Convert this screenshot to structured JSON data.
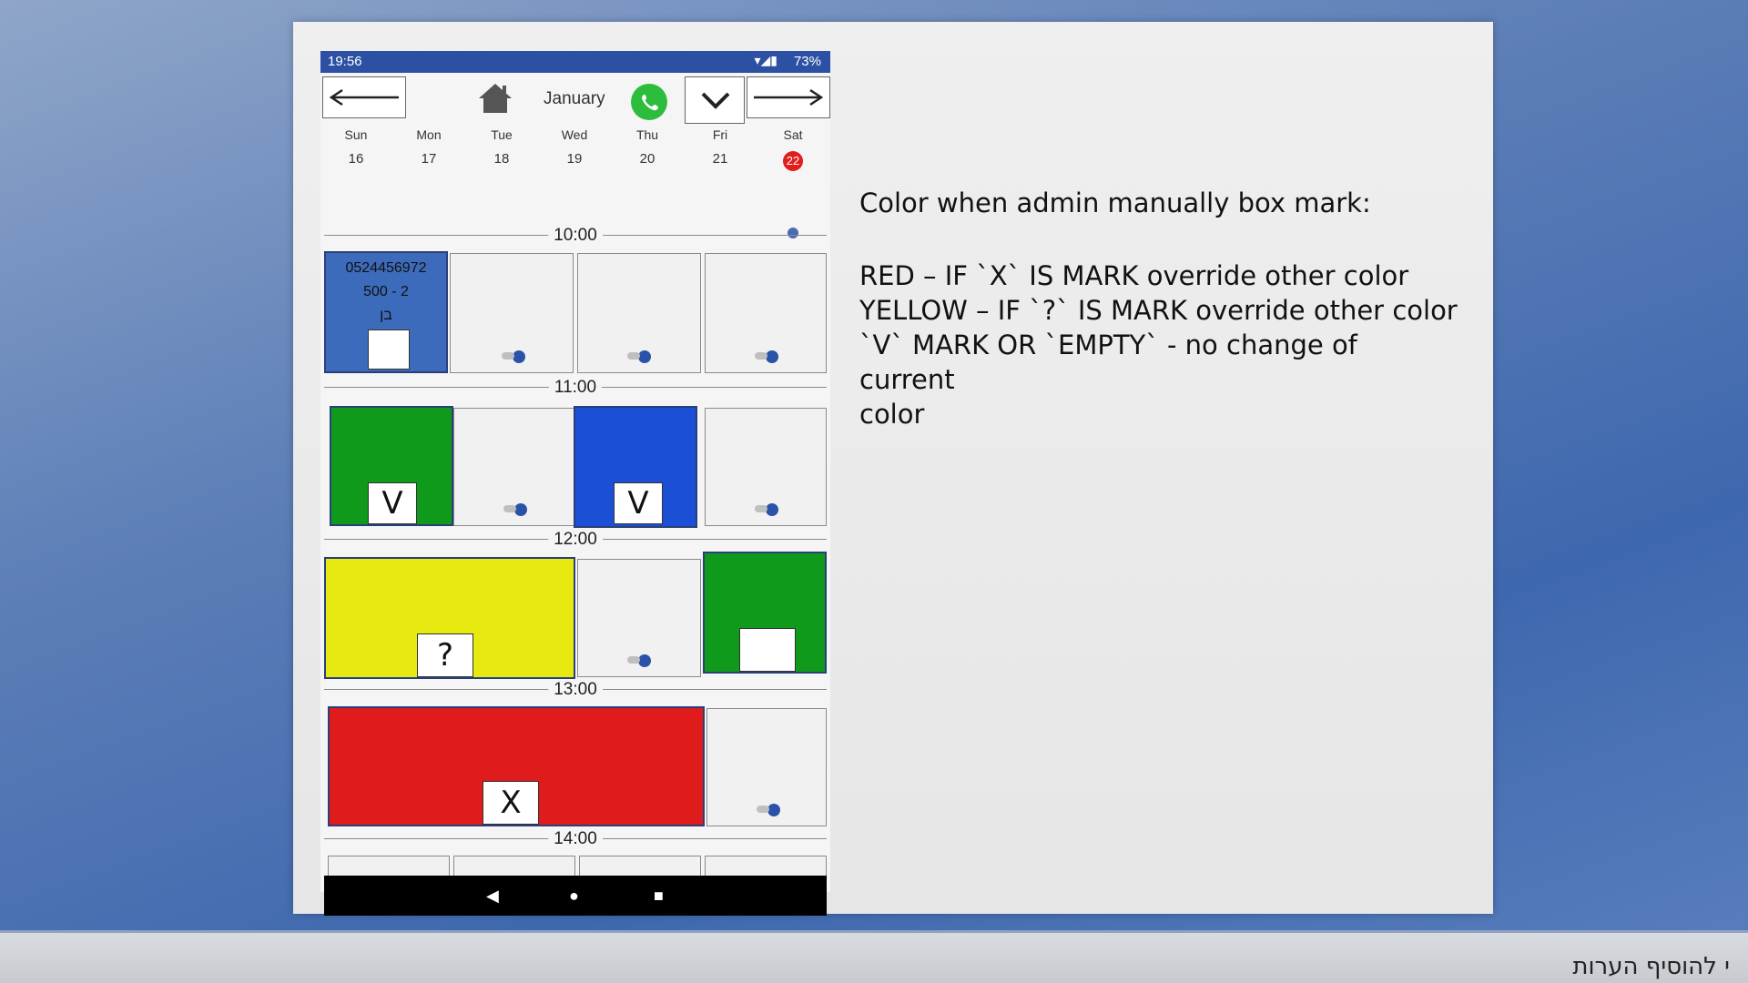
{
  "slide": {
    "heading": "Color when admin manually box mark:",
    "rules": [
      "RED – IF `X` IS MARK override other color",
      "YELLOW – IF `?` IS MARK override other color",
      " `V` MARK OR `EMPTY` - no change of current",
      "color"
    ]
  },
  "footer": {
    "comment": "י להוסיף הערות"
  },
  "phone": {
    "status": {
      "time": "19:56",
      "battery": "73%"
    },
    "toolbar": {
      "month": "January",
      "back_icon": "arrow-left-icon",
      "forward_icon": "arrow-right-icon",
      "home_icon": "home-icon",
      "whatsapp_icon": "whatsapp-icon",
      "dropdown_icon": "chevron-down-icon"
    },
    "days": [
      {
        "name": "Sun",
        "date": "16"
      },
      {
        "name": "Mon",
        "date": "17"
      },
      {
        "name": "Tue",
        "date": "18"
      },
      {
        "name": "Wed",
        "date": "19"
      },
      {
        "name": "Thu",
        "date": "20"
      },
      {
        "name": "Fri",
        "date": "21"
      },
      {
        "name": "Sat",
        "date": "22"
      }
    ],
    "times": [
      "10:00",
      "11:00",
      "12:00",
      "13:00",
      "14:00"
    ],
    "booking": {
      "phone": "0524456972",
      "code": "500 - 2",
      "name": "בן"
    },
    "marks": {
      "v1": "V",
      "v2": "V",
      "q": "?",
      "x": "X"
    },
    "colors": {
      "blue": "#3c6bbb",
      "green": "#0f9a1c",
      "bright_blue": "#1a4fd6",
      "yellow": "#e6ea10",
      "red": "#e01b1b"
    }
  }
}
